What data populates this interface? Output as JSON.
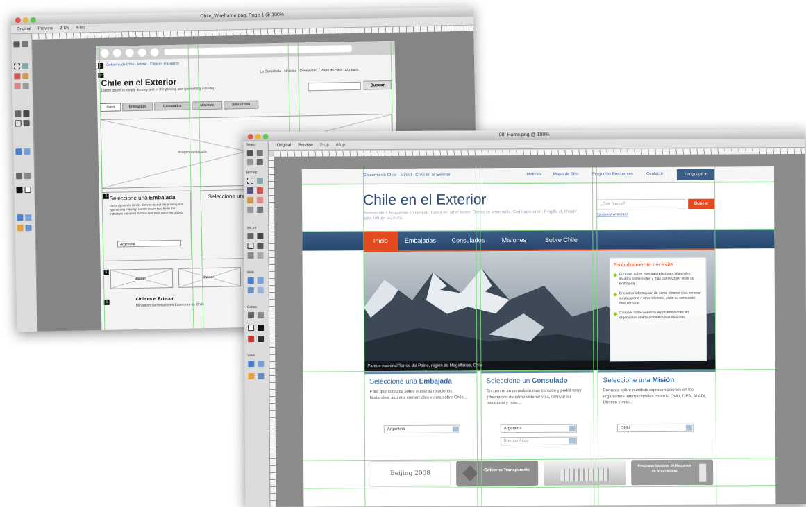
{
  "back_window": {
    "title": "Chile_Wireframe.png, Page 1 @ 100%",
    "options": [
      "Original",
      "Preview",
      "2-Up",
      "4-Up"
    ],
    "wireframe": {
      "breadcrumb": "Gobierno de Chile · Minrel · Chile en el Exterior",
      "site_title": "Chile en el Exterior",
      "tagline": "Lorem ipsum is simply dummy text of the printing and typesetting industry.",
      "top_links": "La Cancillería · Noticias · Comunidad · Mapa de Sitio · Contacto",
      "search_button": "Buscar",
      "tabs": [
        "Inicio",
        "Embajadas",
        "Consulados",
        "Misiones",
        "Sobre Chile"
      ],
      "image_label": "Imagen destacada",
      "section_title_a": "Seleccione una ",
      "section_title_b": "Embajada",
      "section_text": "Lorem ipsum is simply dummy text of the printing and typesetting industry. Lorem ipsum has been the industry's standard dummy text ever since the 1500s.",
      "select_value": "Argentina",
      "banner_label": "Banner",
      "footer_title": "Chile en el Exterior",
      "footer_text": "Ministerio de Relaciones Exteriores de Chile",
      "section_numbers": [
        "1",
        "2",
        "3",
        "4",
        "5",
        "6"
      ]
    }
  },
  "front_window": {
    "title": "00_Home.png @ 100%",
    "options": [
      "Original",
      "Preview",
      "2-Up",
      "4-Up"
    ],
    "tools_labels": [
      "Select",
      "Bitmap",
      "Vector",
      "Web",
      "Colors",
      "View"
    ],
    "site": {
      "breadcrumb": "Gobierno de Chile · Minrel · Chile en el Exterior",
      "util_links": [
        "Noticias",
        "Mapa de Sitio",
        "Preguntas Frecuentes",
        "Contacto"
      ],
      "language_button": "Language ▾",
      "title": "Chile en el Exterior",
      "subtitle": "Aenean nibh. Maecenas consequat massa vel amet lorem. Donec sit amet nulla. Sed turpis enim, fringilla ut, blandit quis, rutrum ac, nulla.",
      "search_placeholder": "¿Qué busca?",
      "search_button": "Buscar",
      "advanced_search": "Búsqueda Avanzada",
      "nav": [
        "Inicio",
        "Embajadas",
        "Consulados",
        "Misiones",
        "Sobre Chile"
      ],
      "hero_caption": "Parque nacional Torres del Paine, región de Magallanes, Chile",
      "needs": {
        "title": "Probablemente necesite...",
        "items": [
          "Conozca sobre nuestras relaciones bilaterales, asuntos comerciales y más sobre Chile, visite su Embajada",
          "Encontrar información de cómo obtener visa, renovar su pasaporte y otros trámites, visite su consulado más cercano.",
          "Conocer sobre nuestras representaciones en organismos internacionales visite Misiones"
        ]
      },
      "cards": [
        {
          "title_a": "Seleccione una ",
          "title_b": "Embajada",
          "text": "Para que conozca sobre nuestras relaciones bilaterales, asuntos comerciales y mas sobre Chile...",
          "select1": "Argentina",
          "select2": ""
        },
        {
          "title_a": "Seleccione un ",
          "title_b": "Consulado",
          "text": "Encuentre su consulado más cercano y podrá tener información de cómo obtener visa, renovar su pasaporte y más...",
          "select1": "Argentina",
          "select2": "Buenos Aires"
        },
        {
          "title_a": "Seleccione una ",
          "title_b": "Misión",
          "text": "Conozca sobre nuestras representaciones en los organismos internacionales como la ONU, OEA, ALADI, Unesco y más...",
          "select1": "ONU",
          "select2": ""
        }
      ],
      "logos": [
        "Beijing 2008",
        "Gobierno Transparente",
        "",
        "Programa Nacional de Recursos de Arquitectura"
      ]
    }
  },
  "colors": {
    "accent_red": "#e34b1e",
    "nav_blue": "#2f507a",
    "title_blue": "#2e4e77",
    "guide_green": "#6fe06f"
  }
}
